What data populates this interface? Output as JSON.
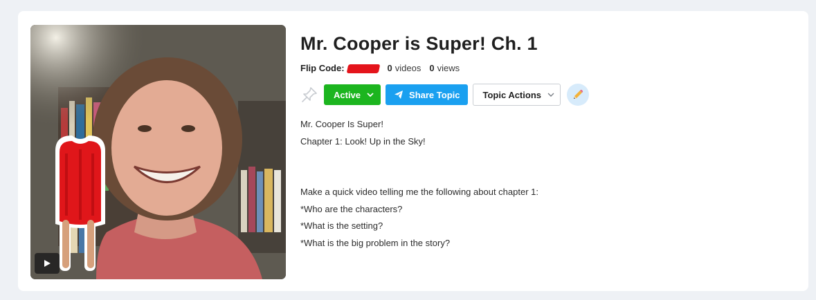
{
  "topic": {
    "title": "Mr. Cooper is Super! Ch. 1",
    "flip_code_label": "Flip Code:",
    "videos_count": "0",
    "videos_label": "videos",
    "views_count": "0",
    "views_label": "views"
  },
  "actions": {
    "status_label": "Active",
    "share_label": "Share Topic",
    "topic_actions_label": "Topic Actions"
  },
  "description": {
    "lines_top": [
      "Mr. Cooper Is Super!",
      "Chapter 1: Look! Up in the Sky!"
    ],
    "lines_bottom": [
      "Make a quick video telling me the following about chapter 1:",
      "*Who are the characters?",
      "*What is the setting?",
      "*What is the big problem in the story?"
    ]
  },
  "icons": {
    "pin": "pin-icon",
    "chevron": "chevron-down-icon",
    "share": "paper-plane-icon",
    "edit": "pencil-icon",
    "play": "play-icon"
  },
  "colors": {
    "active_green": "#1cb51f",
    "share_blue": "#1aa0f0",
    "edit_bg": "#d7ebfb",
    "redaction_red": "#e4141b"
  }
}
